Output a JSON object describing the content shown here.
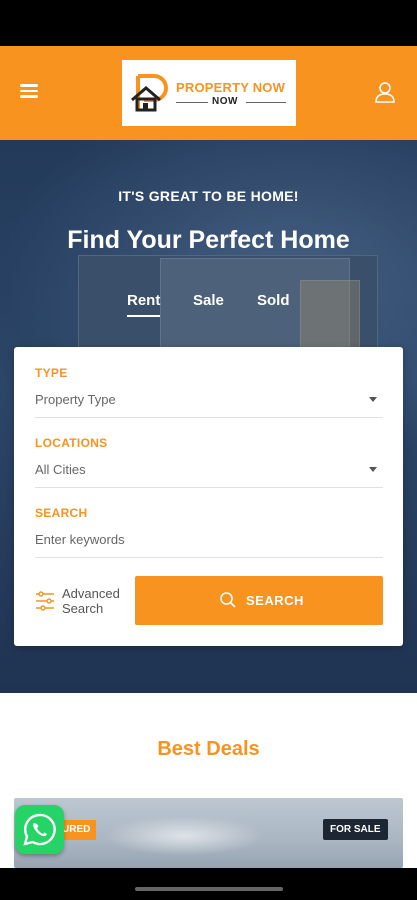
{
  "colors": {
    "brand": "#f7931e",
    "hero_overlay": "#233a5a",
    "badge_dark": "#1d2733",
    "whatsapp": "#25d366"
  },
  "header": {
    "menu_icon": "hamburger-menu-icon",
    "logo": {
      "line1": "PROPERTY NOW",
      "line2": "NOW"
    },
    "user_icon": "user-profile-icon"
  },
  "hero": {
    "kicker": "IT'S GREAT TO BE HOME!",
    "title": "Find Your Perfect Home",
    "tabs": [
      {
        "label": "Rent",
        "active": true
      },
      {
        "label": "Sale",
        "active": false
      },
      {
        "label": "Sold",
        "active": false
      }
    ]
  },
  "search_form": {
    "type": {
      "label": "TYPE",
      "value": "Property Type"
    },
    "locations": {
      "label": "LOCATIONS",
      "value": "All Cities"
    },
    "search": {
      "label": "SEARCH",
      "placeholder": "Enter keywords"
    },
    "advanced": {
      "line1": "Advanced",
      "line2": "Search",
      "icon": "sliders-icon"
    },
    "submit": {
      "label": "SEARCH",
      "icon": "search-icon"
    }
  },
  "deals": {
    "title": "Best Deals",
    "card": {
      "badge_left": "URED",
      "badge_right": "FOR SALE"
    }
  },
  "whatsapp": {
    "icon": "whatsapp-icon"
  }
}
